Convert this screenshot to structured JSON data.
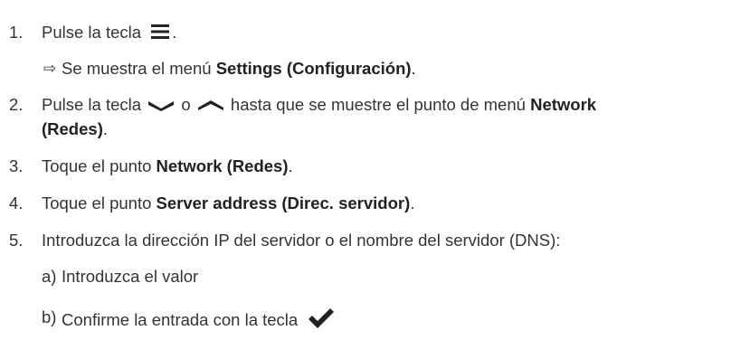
{
  "steps": [
    {
      "num": "1.",
      "pre": "Pulse la tecla",
      "icon": "menu-icon",
      "post": "."
    },
    {
      "num": "2.",
      "pre": "Pulse la tecla",
      "icon1": "chevron-down-icon",
      "mid": "o",
      "icon2": "chevron-up-icon",
      "post": "hasta que se muestre el punto de menú",
      "bold": "Network",
      "bold2": "(Redes)",
      "end": "."
    },
    {
      "num": "3.",
      "pre": "Toque el punto",
      "bold": "Network (Redes)",
      "end": "."
    },
    {
      "num": "4.",
      "pre": "Toque el punto",
      "bold": "Server address (Direc. servidor)",
      "end": "."
    },
    {
      "num": "5.",
      "text": "Introduzca la dirección IP del servidor o el nombre del servidor (DNS):"
    }
  ],
  "result1": {
    "arrow": "⇨",
    "pre": "Se muestra el menú",
    "bold": "Settings (Configuración)",
    "end": "."
  },
  "substeps": [
    {
      "letter": "a)",
      "text": "Introduzca el valor"
    },
    {
      "letter": "b)",
      "text": "Confirme la entrada con la tecla",
      "icon": "checkmark-icon"
    }
  ],
  "colors": {
    "text": "#333333",
    "bold": "#222222"
  }
}
